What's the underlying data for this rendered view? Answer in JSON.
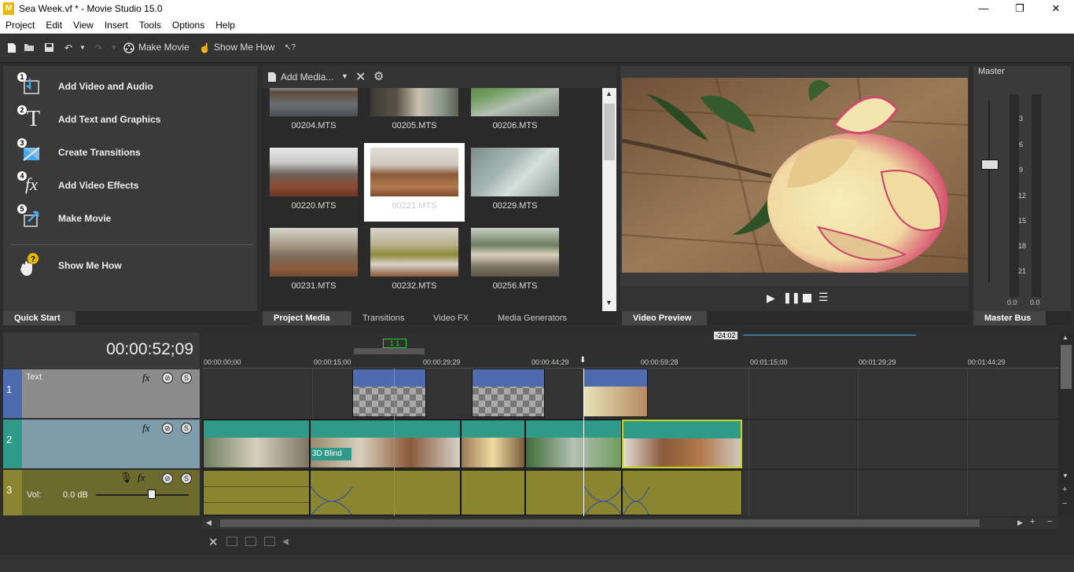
{
  "window": {
    "title": "Sea Week.vf * - Movie Studio 15.0",
    "app_icon": "M",
    "minimize": "—",
    "maximize": "❐",
    "close": "✕"
  },
  "menu": [
    "Project",
    "Edit",
    "View",
    "Insert",
    "Tools",
    "Options",
    "Help"
  ],
  "toolbar": {
    "make_movie": "Make Movie",
    "show_me_how": "Show Me How"
  },
  "quick_start": {
    "items": [
      {
        "num": "1",
        "label": "Add Video and Audio"
      },
      {
        "num": "2",
        "label": "Add Text and Graphics"
      },
      {
        "num": "3",
        "label": "Create Transitions"
      },
      {
        "num": "4",
        "label": "Add Video Effects"
      },
      {
        "num": "5",
        "label": "Make Movie"
      }
    ],
    "help_label": "Show Me How",
    "tab": "Quick Start"
  },
  "project_media": {
    "add_media": "Add Media...",
    "files": [
      "00204.MTS",
      "00205.MTS",
      "00206.MTS",
      "00220.MTS",
      "00221.MTS",
      "00229.MTS",
      "00231.MTS",
      "00232.MTS",
      "00256.MTS"
    ],
    "selected": "00221.MTS",
    "tabs": [
      "Project Media",
      "Transitions",
      "Video FX",
      "Media Generators"
    ],
    "active_tab": "Project Media"
  },
  "video_preview": {
    "tab": "Video Preview"
  },
  "master_bus": {
    "title": "Master",
    "scale": [
      "3",
      "6",
      "9",
      "12",
      "15",
      "18",
      "21"
    ],
    "levels": [
      "0.0",
      "0.0"
    ],
    "tab": "Master Bus"
  },
  "timeline": {
    "timecode": "00:00:52;09",
    "ruler": [
      "00:00:00;00",
      "00:00:15;00",
      "00:00:29;29",
      "00:00:44;29",
      "00:00:59;28",
      "00:01:15;00",
      "00:01:29;29",
      "00:01:44;29"
    ],
    "region_marker": "1 1",
    "loop_label": "-24:02",
    "tracks": [
      {
        "num": "1",
        "name": "Text"
      },
      {
        "num": "2",
        "name": ""
      },
      {
        "num": "3",
        "name": "",
        "vol_label": "Vol:",
        "vol_value": "0.0 dB"
      }
    ],
    "transition_label": "3D Blind"
  },
  "colors": {
    "text_track": "#8c8c8c",
    "video_track": "#7f9cad",
    "audio_track": "#6d6a2e",
    "text_clip": "#4e6bb0",
    "video_clip": "#2e9a87",
    "audio_clip": "#8a8530"
  }
}
